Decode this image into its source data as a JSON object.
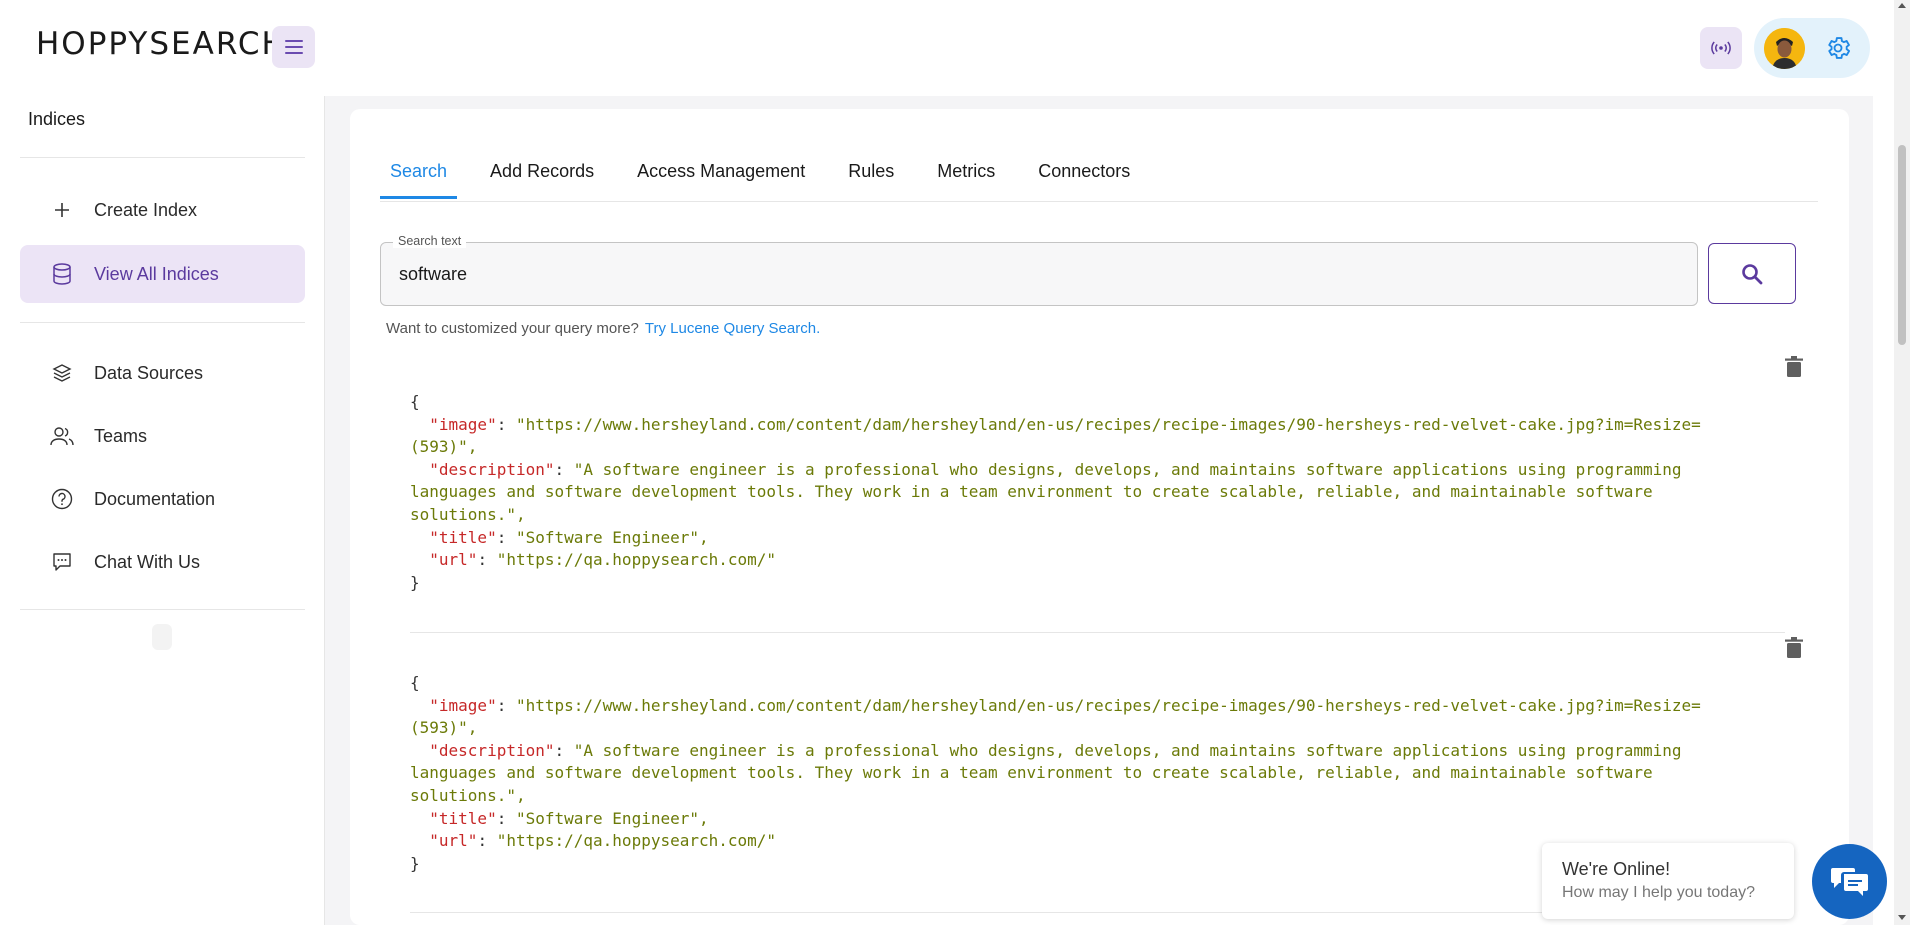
{
  "header": {
    "logo": "HOPPYSEARCH",
    "menu_icon": "hamburger-icon",
    "broadcast_icon": "broadcast-icon",
    "settings_icon": "gear-icon"
  },
  "sidebar": {
    "title": "Indices",
    "items": [
      {
        "label": "Create Index",
        "icon": "plus-icon"
      },
      {
        "label": "View All Indices",
        "icon": "database-icon",
        "active": true
      },
      {
        "label": "Data Sources",
        "icon": "layers-icon"
      },
      {
        "label": "Teams",
        "icon": "users-icon"
      },
      {
        "label": "Documentation",
        "icon": "help-circle-icon"
      },
      {
        "label": "Chat With Us",
        "icon": "chat-icon"
      }
    ]
  },
  "tabs": [
    {
      "label": "Search",
      "active": true
    },
    {
      "label": "Add Records"
    },
    {
      "label": "Access Management"
    },
    {
      "label": "Rules"
    },
    {
      "label": "Metrics"
    },
    {
      "label": "Connectors"
    }
  ],
  "search": {
    "label": "Search text",
    "value": "software",
    "button_icon": "search-icon"
  },
  "hint": {
    "text": "Want to customized your query more?",
    "link": "Try Lucene Query Search."
  },
  "results": [
    {
      "lines": [
        {
          "t": "{"
        },
        {
          "k": "\"image\"",
          "s": "\"https://www.hersheyland.com/content/dam/hersheyland/en-us/recipes/recipe-images/90-hersheys-red-velvet-cake.jpg?im=Resize="
        },
        {
          "s": "(593)\","
        },
        {
          "k": "\"description\"",
          "s": "\"A software engineer is a professional who designs, develops, and maintains software applications using programming"
        },
        {
          "s": "languages and software development tools. They work in a team environment to create scalable, reliable, and maintainable software"
        },
        {
          "s": "solutions.\","
        },
        {
          "k": "\"title\"",
          "s": "\"Software Engineer\","
        },
        {
          "k": "\"url\"",
          "s": "\"https://qa.hoppysearch.com/\""
        },
        {
          "t": "}"
        }
      ]
    },
    {
      "lines": [
        {
          "t": "{"
        },
        {
          "k": "\"image\"",
          "s": "\"https://www.hersheyland.com/content/dam/hersheyland/en-us/recipes/recipe-images/90-hersheys-red-velvet-cake.jpg?im=Resize="
        },
        {
          "s": "(593)\","
        },
        {
          "k": "\"description\"",
          "s": "\"A software engineer is a professional who designs, develops, and maintains software applications using programming"
        },
        {
          "s": "languages and software development tools. They work in a team environment to create scalable, reliable, and maintainable software"
        },
        {
          "s": "solutions.\","
        },
        {
          "k": "\"title\"",
          "s": "\"Software Engineer\","
        },
        {
          "k": "\"url\"",
          "s": "\"https://qa.hoppysearch.com/\""
        },
        {
          "t": "}"
        }
      ]
    }
  ],
  "chat": {
    "title": "We're Online!",
    "subtitle": "How may I help you today?",
    "icon": "chat-bubbles-icon"
  },
  "colors": {
    "accent": "#1e88e5",
    "brand_purple": "#5b3a9e",
    "json_key": "#c62828",
    "json_string": "#6b7a08"
  }
}
